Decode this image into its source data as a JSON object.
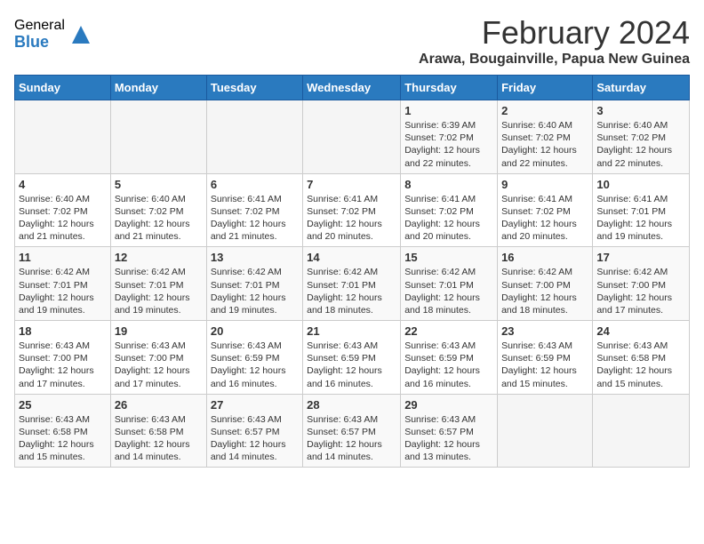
{
  "logo": {
    "general": "General",
    "blue": "Blue"
  },
  "title": "February 2024",
  "location": "Arawa, Bougainville, Papua New Guinea",
  "headers": [
    "Sunday",
    "Monday",
    "Tuesday",
    "Wednesday",
    "Thursday",
    "Friday",
    "Saturday"
  ],
  "weeks": [
    [
      {
        "day": "",
        "info": ""
      },
      {
        "day": "",
        "info": ""
      },
      {
        "day": "",
        "info": ""
      },
      {
        "day": "",
        "info": ""
      },
      {
        "day": "1",
        "info": "Sunrise: 6:39 AM\nSunset: 7:02 PM\nDaylight: 12 hours and 22 minutes."
      },
      {
        "day": "2",
        "info": "Sunrise: 6:40 AM\nSunset: 7:02 PM\nDaylight: 12 hours and 22 minutes."
      },
      {
        "day": "3",
        "info": "Sunrise: 6:40 AM\nSunset: 7:02 PM\nDaylight: 12 hours and 22 minutes."
      }
    ],
    [
      {
        "day": "4",
        "info": "Sunrise: 6:40 AM\nSunset: 7:02 PM\nDaylight: 12 hours and 21 minutes."
      },
      {
        "day": "5",
        "info": "Sunrise: 6:40 AM\nSunset: 7:02 PM\nDaylight: 12 hours and 21 minutes."
      },
      {
        "day": "6",
        "info": "Sunrise: 6:41 AM\nSunset: 7:02 PM\nDaylight: 12 hours and 21 minutes."
      },
      {
        "day": "7",
        "info": "Sunrise: 6:41 AM\nSunset: 7:02 PM\nDaylight: 12 hours and 20 minutes."
      },
      {
        "day": "8",
        "info": "Sunrise: 6:41 AM\nSunset: 7:02 PM\nDaylight: 12 hours and 20 minutes."
      },
      {
        "day": "9",
        "info": "Sunrise: 6:41 AM\nSunset: 7:02 PM\nDaylight: 12 hours and 20 minutes."
      },
      {
        "day": "10",
        "info": "Sunrise: 6:41 AM\nSunset: 7:01 PM\nDaylight: 12 hours and 19 minutes."
      }
    ],
    [
      {
        "day": "11",
        "info": "Sunrise: 6:42 AM\nSunset: 7:01 PM\nDaylight: 12 hours and 19 minutes."
      },
      {
        "day": "12",
        "info": "Sunrise: 6:42 AM\nSunset: 7:01 PM\nDaylight: 12 hours and 19 minutes."
      },
      {
        "day": "13",
        "info": "Sunrise: 6:42 AM\nSunset: 7:01 PM\nDaylight: 12 hours and 19 minutes."
      },
      {
        "day": "14",
        "info": "Sunrise: 6:42 AM\nSunset: 7:01 PM\nDaylight: 12 hours and 18 minutes."
      },
      {
        "day": "15",
        "info": "Sunrise: 6:42 AM\nSunset: 7:01 PM\nDaylight: 12 hours and 18 minutes."
      },
      {
        "day": "16",
        "info": "Sunrise: 6:42 AM\nSunset: 7:00 PM\nDaylight: 12 hours and 18 minutes."
      },
      {
        "day": "17",
        "info": "Sunrise: 6:42 AM\nSunset: 7:00 PM\nDaylight: 12 hours and 17 minutes."
      }
    ],
    [
      {
        "day": "18",
        "info": "Sunrise: 6:43 AM\nSunset: 7:00 PM\nDaylight: 12 hours and 17 minutes."
      },
      {
        "day": "19",
        "info": "Sunrise: 6:43 AM\nSunset: 7:00 PM\nDaylight: 12 hours and 17 minutes."
      },
      {
        "day": "20",
        "info": "Sunrise: 6:43 AM\nSunset: 6:59 PM\nDaylight: 12 hours and 16 minutes."
      },
      {
        "day": "21",
        "info": "Sunrise: 6:43 AM\nSunset: 6:59 PM\nDaylight: 12 hours and 16 minutes."
      },
      {
        "day": "22",
        "info": "Sunrise: 6:43 AM\nSunset: 6:59 PM\nDaylight: 12 hours and 16 minutes."
      },
      {
        "day": "23",
        "info": "Sunrise: 6:43 AM\nSunset: 6:59 PM\nDaylight: 12 hours and 15 minutes."
      },
      {
        "day": "24",
        "info": "Sunrise: 6:43 AM\nSunset: 6:58 PM\nDaylight: 12 hours and 15 minutes."
      }
    ],
    [
      {
        "day": "25",
        "info": "Sunrise: 6:43 AM\nSunset: 6:58 PM\nDaylight: 12 hours and 15 minutes."
      },
      {
        "day": "26",
        "info": "Sunrise: 6:43 AM\nSunset: 6:58 PM\nDaylight: 12 hours and 14 minutes."
      },
      {
        "day": "27",
        "info": "Sunrise: 6:43 AM\nSunset: 6:57 PM\nDaylight: 12 hours and 14 minutes."
      },
      {
        "day": "28",
        "info": "Sunrise: 6:43 AM\nSunset: 6:57 PM\nDaylight: 12 hours and 14 minutes."
      },
      {
        "day": "29",
        "info": "Sunrise: 6:43 AM\nSunset: 6:57 PM\nDaylight: 12 hours and 13 minutes."
      },
      {
        "day": "",
        "info": ""
      },
      {
        "day": "",
        "info": ""
      }
    ]
  ]
}
